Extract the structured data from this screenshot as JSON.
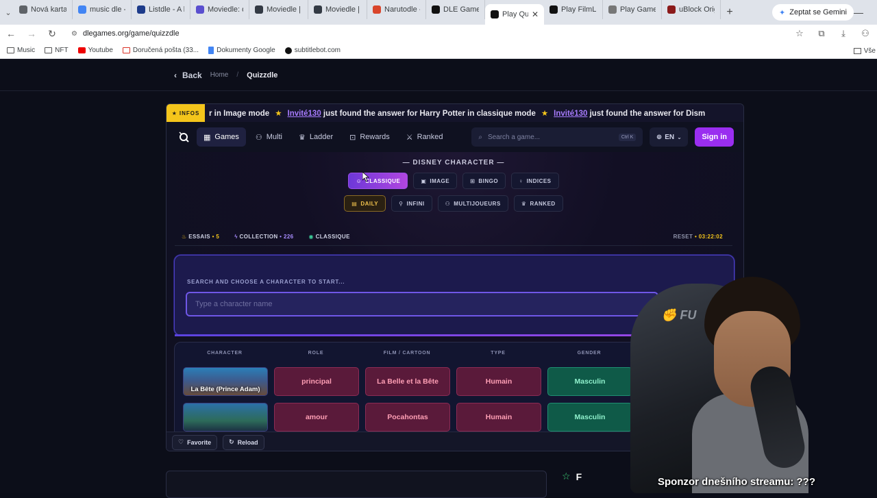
{
  "browser": {
    "tabs": [
      {
        "label": "Nová karta",
        "color": "#5f6368"
      },
      {
        "label": "music dle - Hle",
        "color": "#4285f4"
      },
      {
        "label": "Listdle - A list",
        "color": "#1d3b8a"
      },
      {
        "label": "Moviedle: dail",
        "color": "#5a4fcf"
      },
      {
        "label": "Moviedle | The",
        "color": "#333a44"
      },
      {
        "label": "Moviedle | The",
        "color": "#333a44"
      },
      {
        "label": "Narutodle - K",
        "color": "#d9452b"
      },
      {
        "label": "DLE Games | D",
        "color": "#111111"
      },
      {
        "label": "Play Quizz",
        "color": "#111111",
        "active": true
      },
      {
        "label": "Play FilmLink",
        "color": "#111111"
      },
      {
        "label": "Play Gamedle",
        "color": "#777777"
      },
      {
        "label": "uBlock Origin",
        "color": "#8b1a1a"
      }
    ],
    "gemini_label": "Zeptat se Gemini",
    "url": "dlegames.org/game/quizzdle",
    "bookmarks": [
      {
        "label": "Music",
        "icon": "folder"
      },
      {
        "label": "NFT",
        "icon": "folder"
      },
      {
        "label": "Youtube",
        "icon": "red"
      },
      {
        "label": "Doručená pošta (33...",
        "icon": "gm"
      },
      {
        "label": "Dokumenty Google",
        "icon": "doc"
      },
      {
        "label": "subtitlebot.com",
        "icon": "dot"
      }
    ],
    "bookmarks_right": "Vše"
  },
  "topnav": {
    "back": "Back",
    "home": "Home",
    "sep": "/",
    "current": "Quizzdle"
  },
  "ticker": {
    "badge": "INFOS",
    "prefix": "r in Image mode",
    "user1": "Invité130",
    "text1": " just found the answer for Harry Potter in classique mode",
    "user2": "Invité130",
    "text2": " just found the answer for Dism"
  },
  "gamenav": {
    "games": "Games",
    "multi": "Multi",
    "ladder": "Ladder",
    "rewards": "Rewards",
    "ranked": "Ranked",
    "search_placeholder": "Search a game...",
    "kbd": "Ctrl K",
    "lang": "EN",
    "signin": "Sign in"
  },
  "game": {
    "category": "— DISNEY CHARACTER —",
    "modes": [
      "CLASSIQUE",
      "IMAGE",
      "BINGO",
      "INDICES"
    ],
    "submodes": [
      "DAILY",
      "INFINI",
      "MULTIJOUEURS",
      "RANKED"
    ],
    "stats": {
      "essais_label": "ESSAIS",
      "essais_value": "5",
      "collection_label": "COLLECTION",
      "collection_value": "226",
      "mode_label": "CLASSIQUE",
      "reset_label": "RESET",
      "reset_value": "03:22:02",
      "dot": "•"
    },
    "search_label": "SEARCH AND CHOOSE A CHARACTER TO START...",
    "search_placeholder": "Type a character name",
    "columns": [
      "CHARACTER",
      "ROLE",
      "FILM / CARTOON",
      "TYPE",
      "GENDER"
    ],
    "rows": [
      {
        "character": "La Bête (Prince Adam)",
        "role": "principal",
        "film": "La Belle et la Bête",
        "type": "Humain",
        "gender": "Masculin"
      },
      {
        "character": "",
        "role": "amour",
        "film": "Pocahontas",
        "type": "Humain",
        "gender": "Masculin"
      }
    ],
    "footer": {
      "favorite": "Favorite",
      "reload": "Reload"
    }
  },
  "below": {
    "heading": "F"
  },
  "stream": {
    "caption": "Sponzor dnešního streamu: ???"
  },
  "colors": {
    "accent": "#9a2ef0",
    "gold": "#f4c51b",
    "bad": "#5a1a3a",
    "good": "#0f5a48"
  }
}
